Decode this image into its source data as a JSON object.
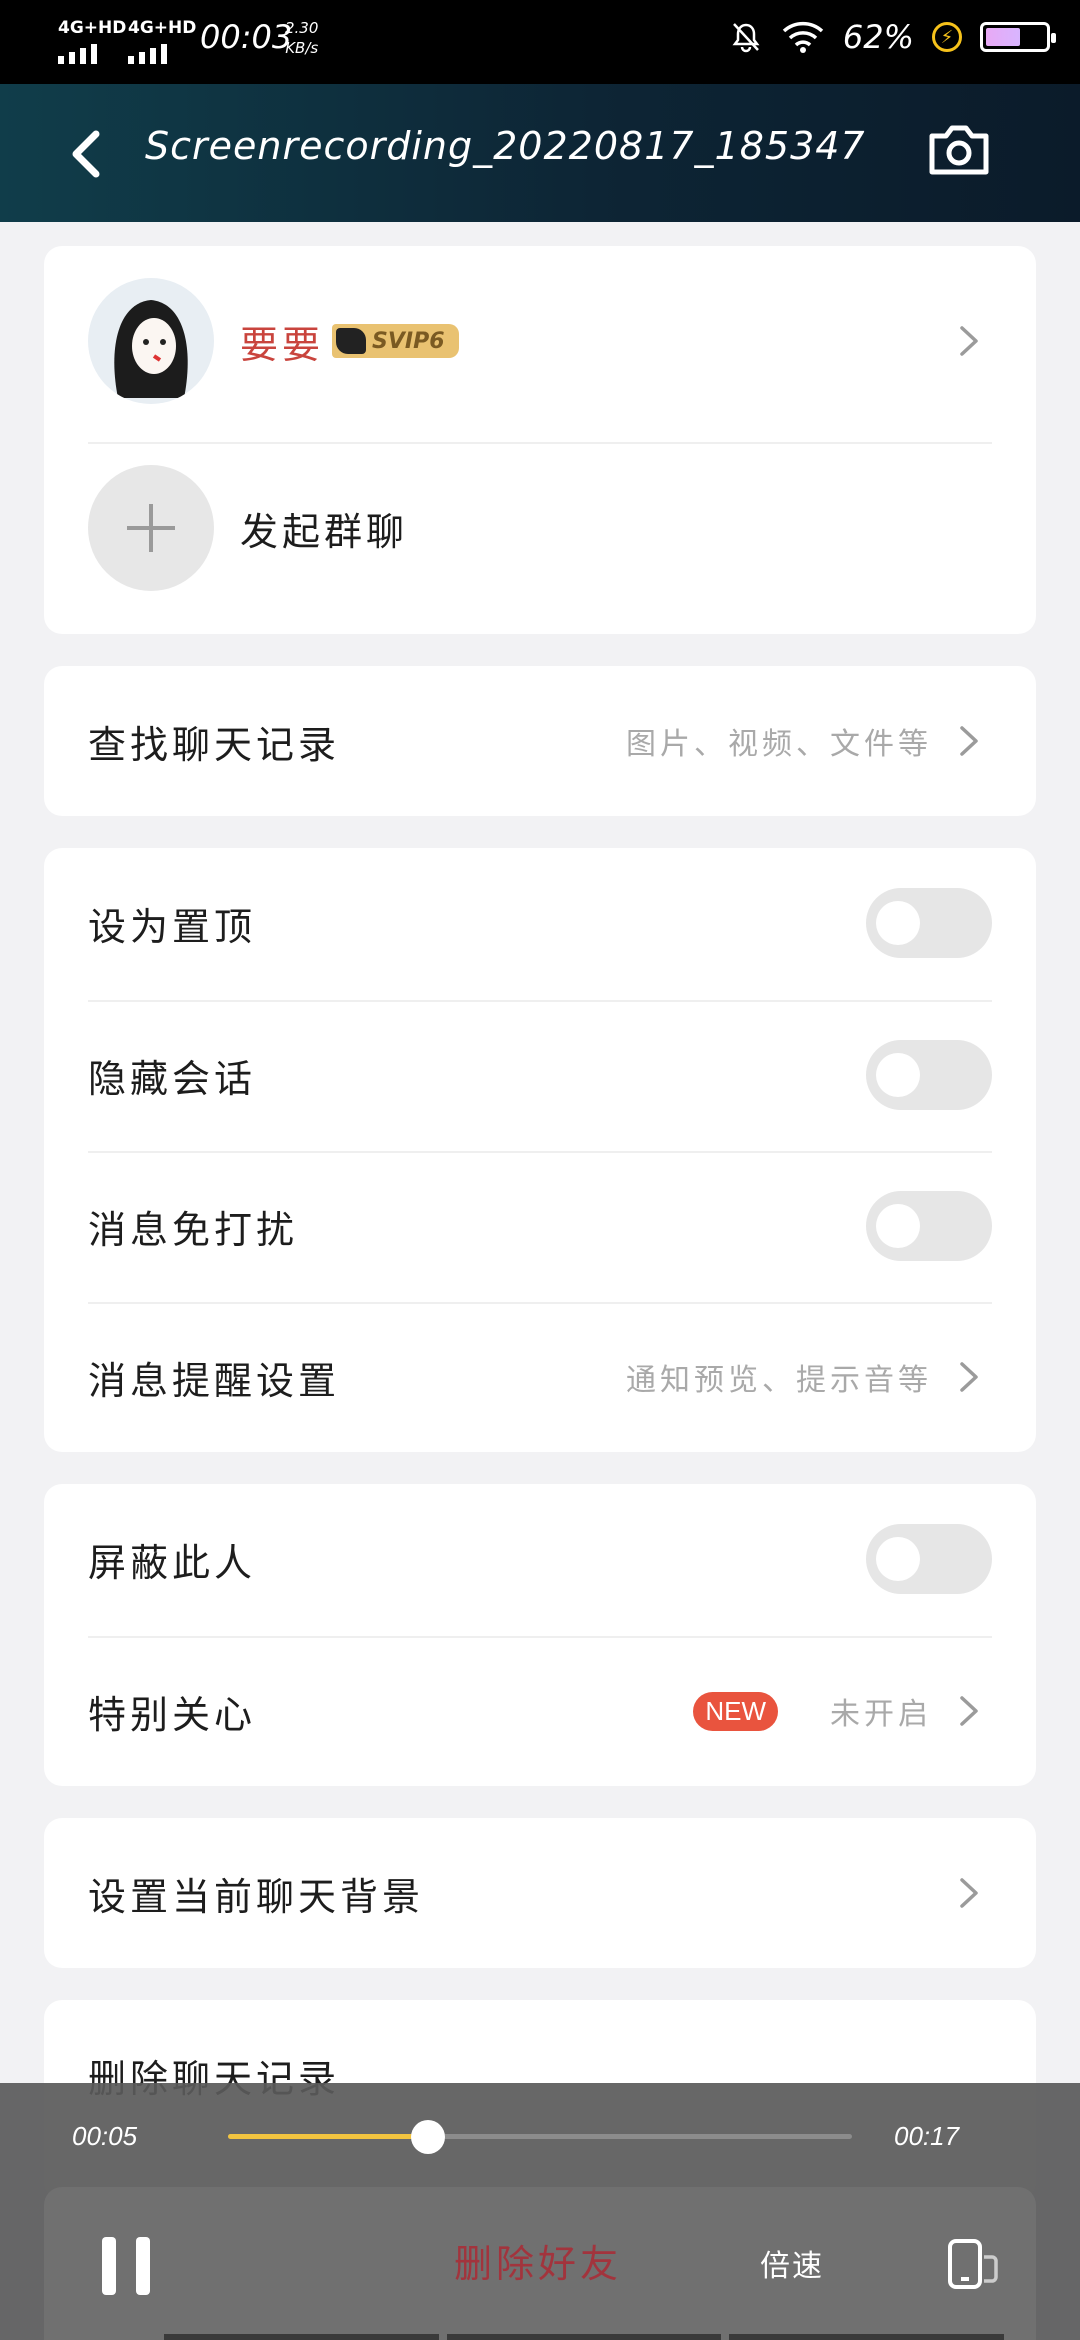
{
  "status_bar": {
    "sim1": "4G+HD",
    "sim2": "4G+HD",
    "time": "00:03",
    "net_speed_value": "2.30",
    "net_speed_unit": "KB/s",
    "battery_percent": "62%",
    "battery_level": 0.62
  },
  "header": {
    "title": "Screenrecording_20220817_185347"
  },
  "profile": {
    "name": "要要",
    "vip_badge": "SVIP6",
    "start_group_chat": "发起群聊"
  },
  "search": {
    "label": "查找聊天记录",
    "hint": "图片、视频、文件等"
  },
  "settings": {
    "pin_top": "设为置顶",
    "hide_chat": "隐藏会话",
    "do_not_disturb": "消息免打扰",
    "notify_settings": "消息提醒设置",
    "notify_hint": "通知预览、提示音等"
  },
  "privacy": {
    "block": "屏蔽此人",
    "special_care": "特别关心",
    "new_badge": "NEW",
    "special_care_state": "未开启"
  },
  "background": {
    "label": "设置当前聊天背景"
  },
  "danger": {
    "delete_history": "删除聊天记录",
    "delete_friend": "删除好友"
  },
  "player": {
    "current_time": "00:05",
    "total_time": "00:17",
    "progress": 0.32,
    "speed_label": "倍速"
  },
  "colors": {
    "header_bg": "#0d2535",
    "accent_progress": "#f2c440",
    "new_badge": "#e9543e",
    "name": "#c9443d"
  }
}
